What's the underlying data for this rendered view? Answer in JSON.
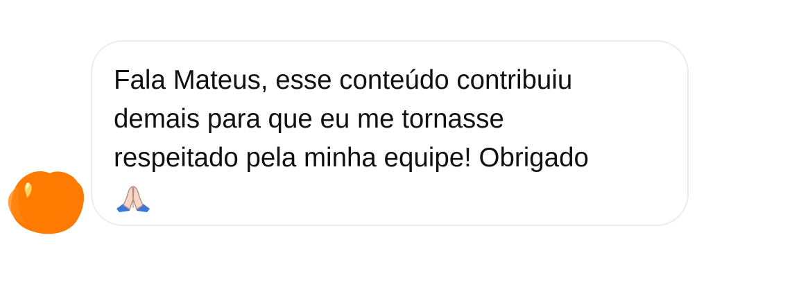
{
  "message": {
    "text": "Fala Mateus, esse conteúdo contribuiu\ndemais para que eu me tornasse\nrespeitado pela minha equipe! Obrigado",
    "emoji": "folded-hands-icon"
  },
  "avatar": {
    "redaction_color": "#ff7a00"
  },
  "colors": {
    "bubble_border": "#ececec",
    "text": "#111111",
    "background": "#ffffff"
  }
}
